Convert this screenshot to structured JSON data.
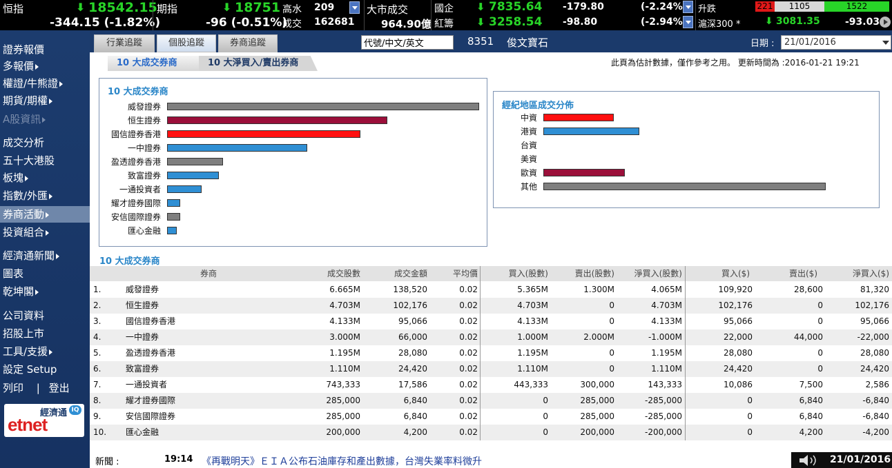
{
  "ticker": {
    "hsi_label": "恒指",
    "hsi_value": "18542.15",
    "hsi_change": "-344.15 (-1.82%)",
    "fut_label": "期指",
    "fut_value": "18751",
    "fut_change": "-96 (-0.51%)",
    "hi_label": "高水",
    "hi_value": "209",
    "vol_label": "成交",
    "vol_value": "162681",
    "mkt_label": "大市成交",
    "mkt_value": "964.90億",
    "hscei_label": "國企",
    "hscei_value": "7835.64",
    "hscei_change": "-179.80",
    "hscei_pct": "(-2.24%)",
    "red_label": "紅籌",
    "red_value": "3258.54",
    "red_change": "-98.80",
    "red_pct": "(-2.94%)",
    "adv_label": "升跌",
    "adv_up": "221",
    "adv_unch": "1105",
    "adv_down": "1522",
    "csi_label": "滬深300 *",
    "csi_value": "3081.35",
    "csi_change": "-93.03"
  },
  "sidebar": {
    "items": [
      {
        "label": "證券報價",
        "arrow": false,
        "dim": false,
        "active": false
      },
      {
        "label": "多報價",
        "arrow": true,
        "dim": false,
        "active": false
      },
      {
        "label": "權證/牛熊證",
        "arrow": true,
        "dim": false,
        "active": false
      },
      {
        "label": "期貨/期權",
        "arrow": true,
        "dim": false,
        "active": false
      },
      {
        "label": "A股資訊",
        "arrow": true,
        "dim": true,
        "active": false
      },
      {
        "label": "成交分析",
        "arrow": false,
        "dim": false,
        "active": false
      },
      {
        "label": "五十大港股",
        "arrow": false,
        "dim": false,
        "active": false
      },
      {
        "label": "板塊",
        "arrow": true,
        "dim": false,
        "active": false
      },
      {
        "label": "指數/外匯",
        "arrow": true,
        "dim": false,
        "active": false
      },
      {
        "label": "券商活動",
        "arrow": true,
        "dim": false,
        "active": true
      },
      {
        "label": "投資組合",
        "arrow": true,
        "dim": false,
        "active": false
      },
      {
        "label": "經濟通新聞",
        "arrow": true,
        "dim": false,
        "active": false
      },
      {
        "label": "圖表",
        "arrow": false,
        "dim": false,
        "active": false
      },
      {
        "label": "乾坤閣",
        "arrow": true,
        "dim": false,
        "active": false
      },
      {
        "label": "公司資料",
        "arrow": false,
        "dim": false,
        "active": false
      },
      {
        "label": "招股上市",
        "arrow": false,
        "dim": false,
        "active": false
      },
      {
        "label": "工具/支援",
        "arrow": true,
        "dim": false,
        "active": false
      },
      {
        "label": "設定 Setup",
        "arrow": false,
        "dim": false,
        "active": false
      }
    ],
    "print_label": "列印",
    "logout_label": "登出",
    "logo_text": "經濟通",
    "logo_brand": "etnet",
    "logo_badge": "IQ"
  },
  "tabs": [
    {
      "label": "行業追蹤",
      "active": false
    },
    {
      "label": "個股追蹤",
      "active": true
    },
    {
      "label": "券商追蹤",
      "active": false
    }
  ],
  "search": {
    "value": "代號/中文/英文"
  },
  "stock": {
    "code": "8351",
    "name": "俊文寶石"
  },
  "date_label": "日期 :",
  "date_value": "21/01/2016",
  "subtabs": [
    {
      "label": "10 大成交券商",
      "active": true
    },
    {
      "label": "10 大淨買入/賣出券商",
      "active": false
    }
  ],
  "notice": "此頁為估計數據，僅作參考之用。 更新時間為 :2016-01-21 19:21",
  "colors": {
    "gray": "#7f7f7f",
    "maroon": "#9b0f3a",
    "red": "#ff1010",
    "blue": "#2f8fd4",
    "up_green": "#28d428",
    "down_red": "#e01818"
  },
  "broker_chart": {
    "title": "10 大成交券商",
    "max": 6.665,
    "bars": [
      {
        "label": "威發證券",
        "value": 6.665,
        "color": "gray"
      },
      {
        "label": "恒生證券",
        "value": 4.703,
        "color": "maroon"
      },
      {
        "label": "國信證券香港",
        "value": 4.133,
        "color": "red"
      },
      {
        "label": "一中證券",
        "value": 3.0,
        "color": "blue"
      },
      {
        "label": "盈透證券香港",
        "value": 1.195,
        "color": "gray"
      },
      {
        "label": "致富證券",
        "value": 1.11,
        "color": "blue"
      },
      {
        "label": "一通投資者",
        "value": 0.743333,
        "color": "blue"
      },
      {
        "label": "耀才證券國際",
        "value": 0.285,
        "color": "blue"
      },
      {
        "label": "安信國際證券",
        "value": 0.285,
        "color": "gray"
      },
      {
        "label": "匯心金融",
        "value": 0.2,
        "color": "blue"
      }
    ]
  },
  "region_chart": {
    "title": "經紀地區成交分佈",
    "max": 100,
    "bars": [
      {
        "label": "中資",
        "value": 25,
        "color": "red"
      },
      {
        "label": "港資",
        "value": 34,
        "color": "blue"
      },
      {
        "label": "台資",
        "value": 0,
        "color": "blue"
      },
      {
        "label": "美資",
        "value": 0,
        "color": "blue"
      },
      {
        "label": "歐資",
        "value": 28.9,
        "color": "maroon"
      },
      {
        "label": "其他",
        "value": 100,
        "color": "gray"
      }
    ]
  },
  "table": {
    "title": "10 大成交券商",
    "headers": [
      "券商",
      "成交股數",
      "成交金額",
      "平均價",
      "買入(股數)",
      "賣出(股數)",
      "淨買入(股數)",
      "買入($)",
      "賣出($)",
      "淨買入($)"
    ],
    "rows": [
      [
        "1.",
        "威發證券",
        "6.665M",
        "138,520",
        "0.02",
        "5.365M",
        "1.300M",
        "4.065M",
        "109,920",
        "28,600",
        "81,320"
      ],
      [
        "2.",
        "恒生證券",
        "4.703M",
        "102,176",
        "0.02",
        "4.703M",
        "0",
        "4.703M",
        "102,176",
        "0",
        "102,176"
      ],
      [
        "3.",
        "國信證券香港",
        "4.133M",
        "95,066",
        "0.02",
        "4.133M",
        "0",
        "4.133M",
        "95,066",
        "0",
        "95,066"
      ],
      [
        "4.",
        "一中證券",
        "3.000M",
        "66,000",
        "0.02",
        "1.000M",
        "2.000M",
        "-1.000M",
        "22,000",
        "44,000",
        "-22,000"
      ],
      [
        "5.",
        "盈透證券香港",
        "1.195M",
        "28,080",
        "0.02",
        "1.195M",
        "0",
        "1.195M",
        "28,080",
        "0",
        "28,080"
      ],
      [
        "6.",
        "致富證券",
        "1.110M",
        "24,420",
        "0.02",
        "1.110M",
        "0",
        "1.110M",
        "24,420",
        "0",
        "24,420"
      ],
      [
        "7.",
        "一通投資者",
        "743,333",
        "17,586",
        "0.02",
        "443,333",
        "300,000",
        "143,333",
        "10,086",
        "7,500",
        "2,586"
      ],
      [
        "8.",
        "耀才證券國際",
        "285,000",
        "6,840",
        "0.02",
        "0",
        "285,000",
        "-285,000",
        "0",
        "6,840",
        "-6,840"
      ],
      [
        "9.",
        "安信國際證券",
        "285,000",
        "6,840",
        "0.02",
        "0",
        "285,000",
        "-285,000",
        "0",
        "6,840",
        "-6,840"
      ],
      [
        "10.",
        "匯心金融",
        "200,000",
        "4,200",
        "0.02",
        "0",
        "200,000",
        "-200,000",
        "0",
        "4,200",
        "-4,200"
      ]
    ]
  },
  "news": {
    "label": "新聞 :",
    "time": "19:14",
    "headline": "《再戰明天》ＥＩＡ公布石油庫存和產出數據，台灣失業率料微升"
  },
  "footer_date": "21/01/2016"
}
